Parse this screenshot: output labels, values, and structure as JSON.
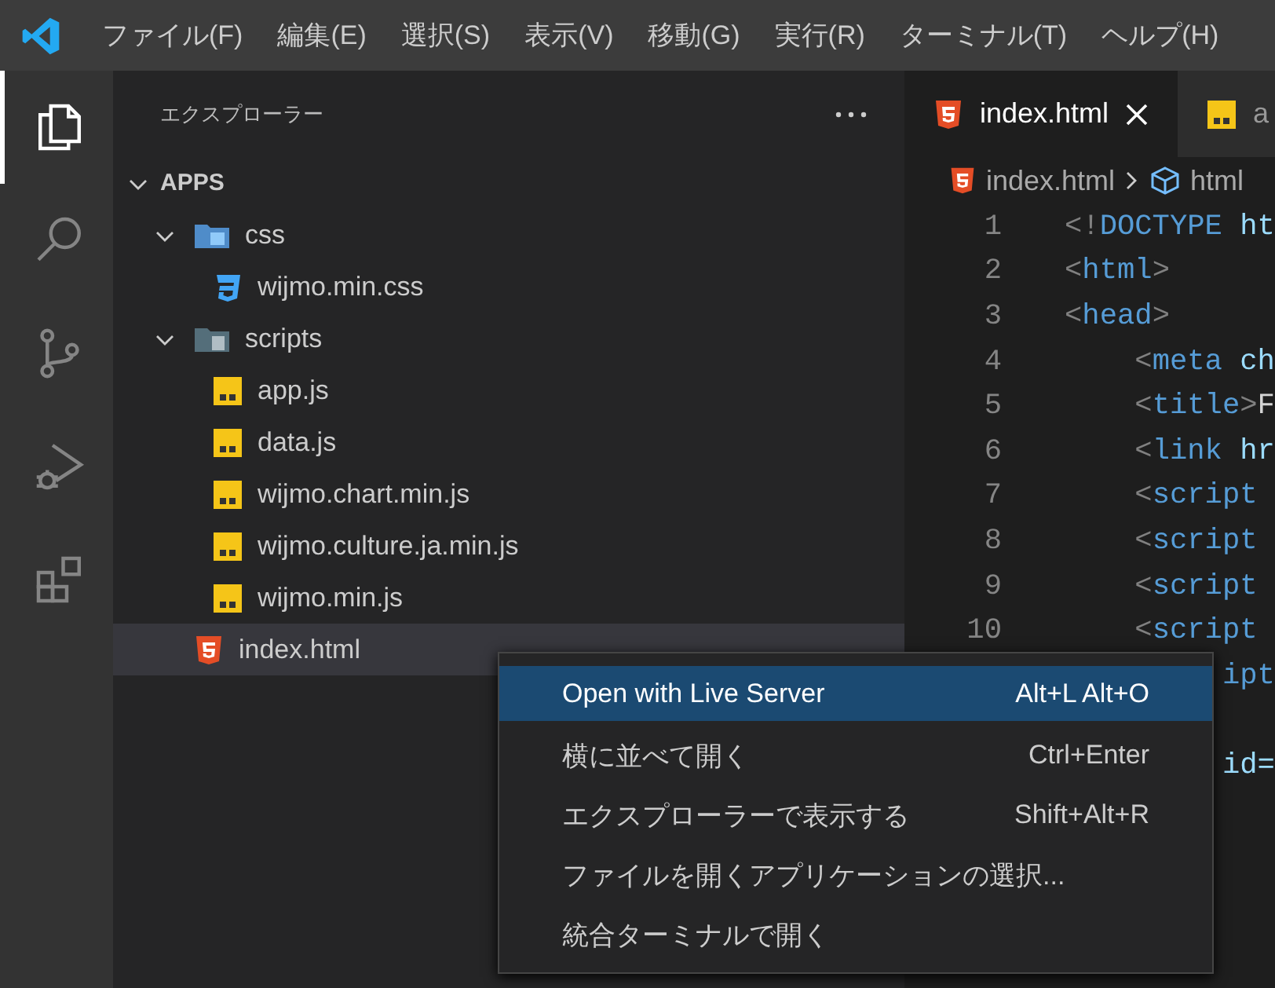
{
  "menu_bar": {
    "items": [
      "ファイル(F)",
      "編集(E)",
      "選択(S)",
      "表示(V)",
      "移動(G)",
      "実行(R)",
      "ターミナル(T)",
      "ヘルプ(H)"
    ]
  },
  "activity_bar": {
    "items": [
      {
        "kind": "explorer",
        "selected": true
      },
      {
        "kind": "search",
        "selected": false
      },
      {
        "kind": "source-control",
        "selected": false
      },
      {
        "kind": "debug",
        "selected": false
      },
      {
        "kind": "extensions",
        "selected": false
      }
    ]
  },
  "sidebar": {
    "title": "エクスプローラー",
    "tree": {
      "label": "APPS",
      "kind": "root",
      "expanded": true,
      "selected": false,
      "children": [
        {
          "label": "css",
          "kind": "folder-css",
          "expanded": true,
          "selected": false,
          "children": [
            {
              "label": "wijmo.min.css",
              "kind": "css",
              "selected": false
            }
          ]
        },
        {
          "label": "scripts",
          "kind": "folder-scripts",
          "expanded": true,
          "selected": false,
          "children": [
            {
              "label": "app.js",
              "kind": "js",
              "selected": false
            },
            {
              "label": "data.js",
              "kind": "js",
              "selected": false
            },
            {
              "label": "wijmo.chart.min.js",
              "kind": "js",
              "selected": false
            },
            {
              "label": "wijmo.culture.ja.min.js",
              "kind": "js",
              "selected": false
            },
            {
              "label": "wijmo.min.js",
              "kind": "js",
              "selected": false
            }
          ]
        },
        {
          "label": "index.html",
          "kind": "html",
          "selected": true
        }
      ]
    }
  },
  "tabs": [
    {
      "label": "index.html",
      "kind": "html",
      "selected": true
    },
    {
      "label": "a",
      "kind": "js",
      "selected": false
    }
  ],
  "breadcrumb": [
    {
      "label": "index.html",
      "kind": "html"
    },
    {
      "label": "html",
      "kind": "element"
    }
  ],
  "code": [
    {
      "number": "1",
      "tokens": [
        {
          "kind": "punct",
          "text": "<!"
        },
        {
          "kind": "tag",
          "text": "DOCTYPE"
        },
        {
          "kind": "attr",
          "text": " ht"
        }
      ]
    },
    {
      "number": "2",
      "tokens": [
        {
          "kind": "punct",
          "text": "<"
        },
        {
          "kind": "tag",
          "text": "html"
        },
        {
          "kind": "punct",
          "text": ">"
        }
      ]
    },
    {
      "number": "3",
      "tokens": [
        {
          "kind": "punct",
          "text": "<"
        },
        {
          "kind": "tag",
          "text": "head"
        },
        {
          "kind": "punct",
          "text": ">"
        }
      ]
    },
    {
      "number": "4",
      "tokens": [
        {
          "kind": "punct",
          "text": "    <"
        },
        {
          "kind": "tag",
          "text": "meta"
        },
        {
          "kind": "attr",
          "text": " ch"
        }
      ]
    },
    {
      "number": "5",
      "tokens": [
        {
          "kind": "punct",
          "text": "    <"
        },
        {
          "kind": "tag",
          "text": "title"
        },
        {
          "kind": "punct",
          "text": ">"
        },
        {
          "kind": "text",
          "text": "F"
        }
      ]
    },
    {
      "number": "6",
      "tokens": [
        {
          "kind": "punct",
          "text": "    <"
        },
        {
          "kind": "tag",
          "text": "link"
        },
        {
          "kind": "attr",
          "text": " hr"
        }
      ]
    },
    {
      "number": "7",
      "tokens": [
        {
          "kind": "punct",
          "text": "    <"
        },
        {
          "kind": "tag",
          "text": "script"
        }
      ]
    },
    {
      "number": "8",
      "tokens": [
        {
          "kind": "punct",
          "text": "    <"
        },
        {
          "kind": "tag",
          "text": "script"
        }
      ]
    },
    {
      "number": "9",
      "tokens": [
        {
          "kind": "punct",
          "text": "    <"
        },
        {
          "kind": "tag",
          "text": "script"
        }
      ]
    },
    {
      "number": "10",
      "tokens": [
        {
          "kind": "punct",
          "text": "    <"
        },
        {
          "kind": "tag",
          "text": "script"
        }
      ]
    },
    {
      "tokens": [
        {
          "kind": "tag",
          "text": "         ipt"
        }
      ]
    },
    {
      "kind": "blank"
    },
    {
      "tokens": [
        {
          "kind": "attr",
          "text": "         id="
        }
      ]
    }
  ],
  "context_menu": {
    "items": [
      {
        "label": "Open with Live Server",
        "shortcut": "Alt+L Alt+O",
        "selected": true
      },
      {
        "label": "横に並べて開く",
        "shortcut": "Ctrl+Enter",
        "selected": false
      },
      {
        "label": "エクスプローラーで表示する",
        "shortcut": "Shift+Alt+R",
        "selected": false
      },
      {
        "label": "ファイルを開くアプリケーションの選択...",
        "selected": false
      },
      {
        "label": "統合ターミナルで開く",
        "selected": false
      }
    ]
  }
}
